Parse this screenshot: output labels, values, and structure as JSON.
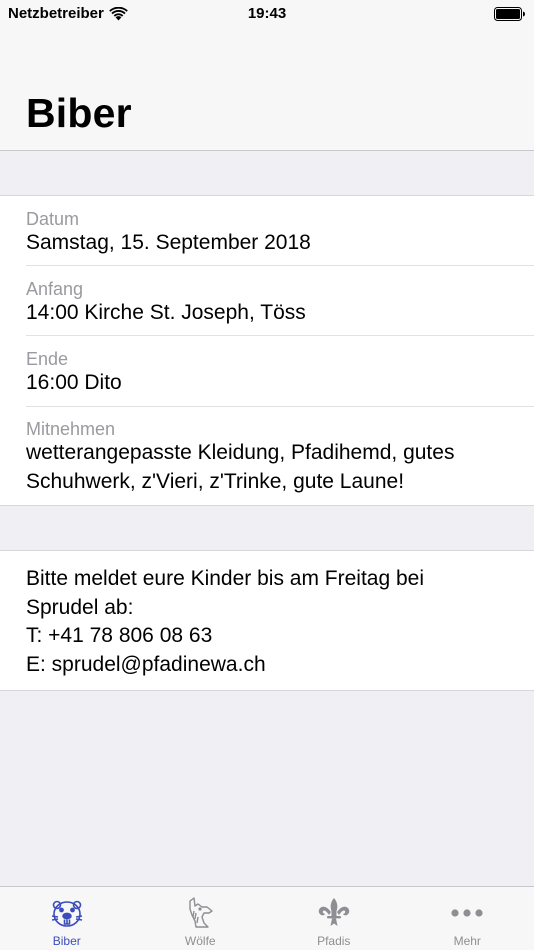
{
  "status_bar": {
    "carrier": "Netzbetreiber",
    "time": "19:43",
    "wifi_icon": "wifi-icon",
    "battery_icon": "battery-icon"
  },
  "nav": {
    "title": "Biber"
  },
  "details": [
    {
      "label": "Datum",
      "value_lines": [
        "Samstag, 15. September 2018"
      ]
    },
    {
      "label": "Anfang",
      "value_lines": [
        "14:00 Kirche St. Joseph, Töss"
      ]
    },
    {
      "label": "Ende",
      "value_lines": [
        "16:00 Dito"
      ]
    },
    {
      "label": "Mitnehmen",
      "value_lines": [
        "wetterangepasste Kleidung, Pfadihemd, gutes",
        "Schuhwerk, z'Vieri, z'Trinke, gute Laune!"
      ]
    }
  ],
  "note": {
    "lines": [
      "Bitte meldet eure Kinder bis am Freitag bei",
      "Sprudel ab:",
      "T: +41 78 806 08 63",
      "E: sprudel@pfadinewa.ch"
    ]
  },
  "tabbar": {
    "active_color": "#3b4dbb",
    "inactive_color": "#8e8e93",
    "tabs": [
      {
        "label": "Biber",
        "icon": "beaver-icon",
        "active": true
      },
      {
        "label": "Wölfe",
        "icon": "wolf-icon",
        "active": false
      },
      {
        "label": "Pfadis",
        "icon": "fleur-de-lis-icon",
        "active": false
      },
      {
        "label": "Mehr",
        "icon": "more-icon",
        "active": false
      }
    ]
  }
}
